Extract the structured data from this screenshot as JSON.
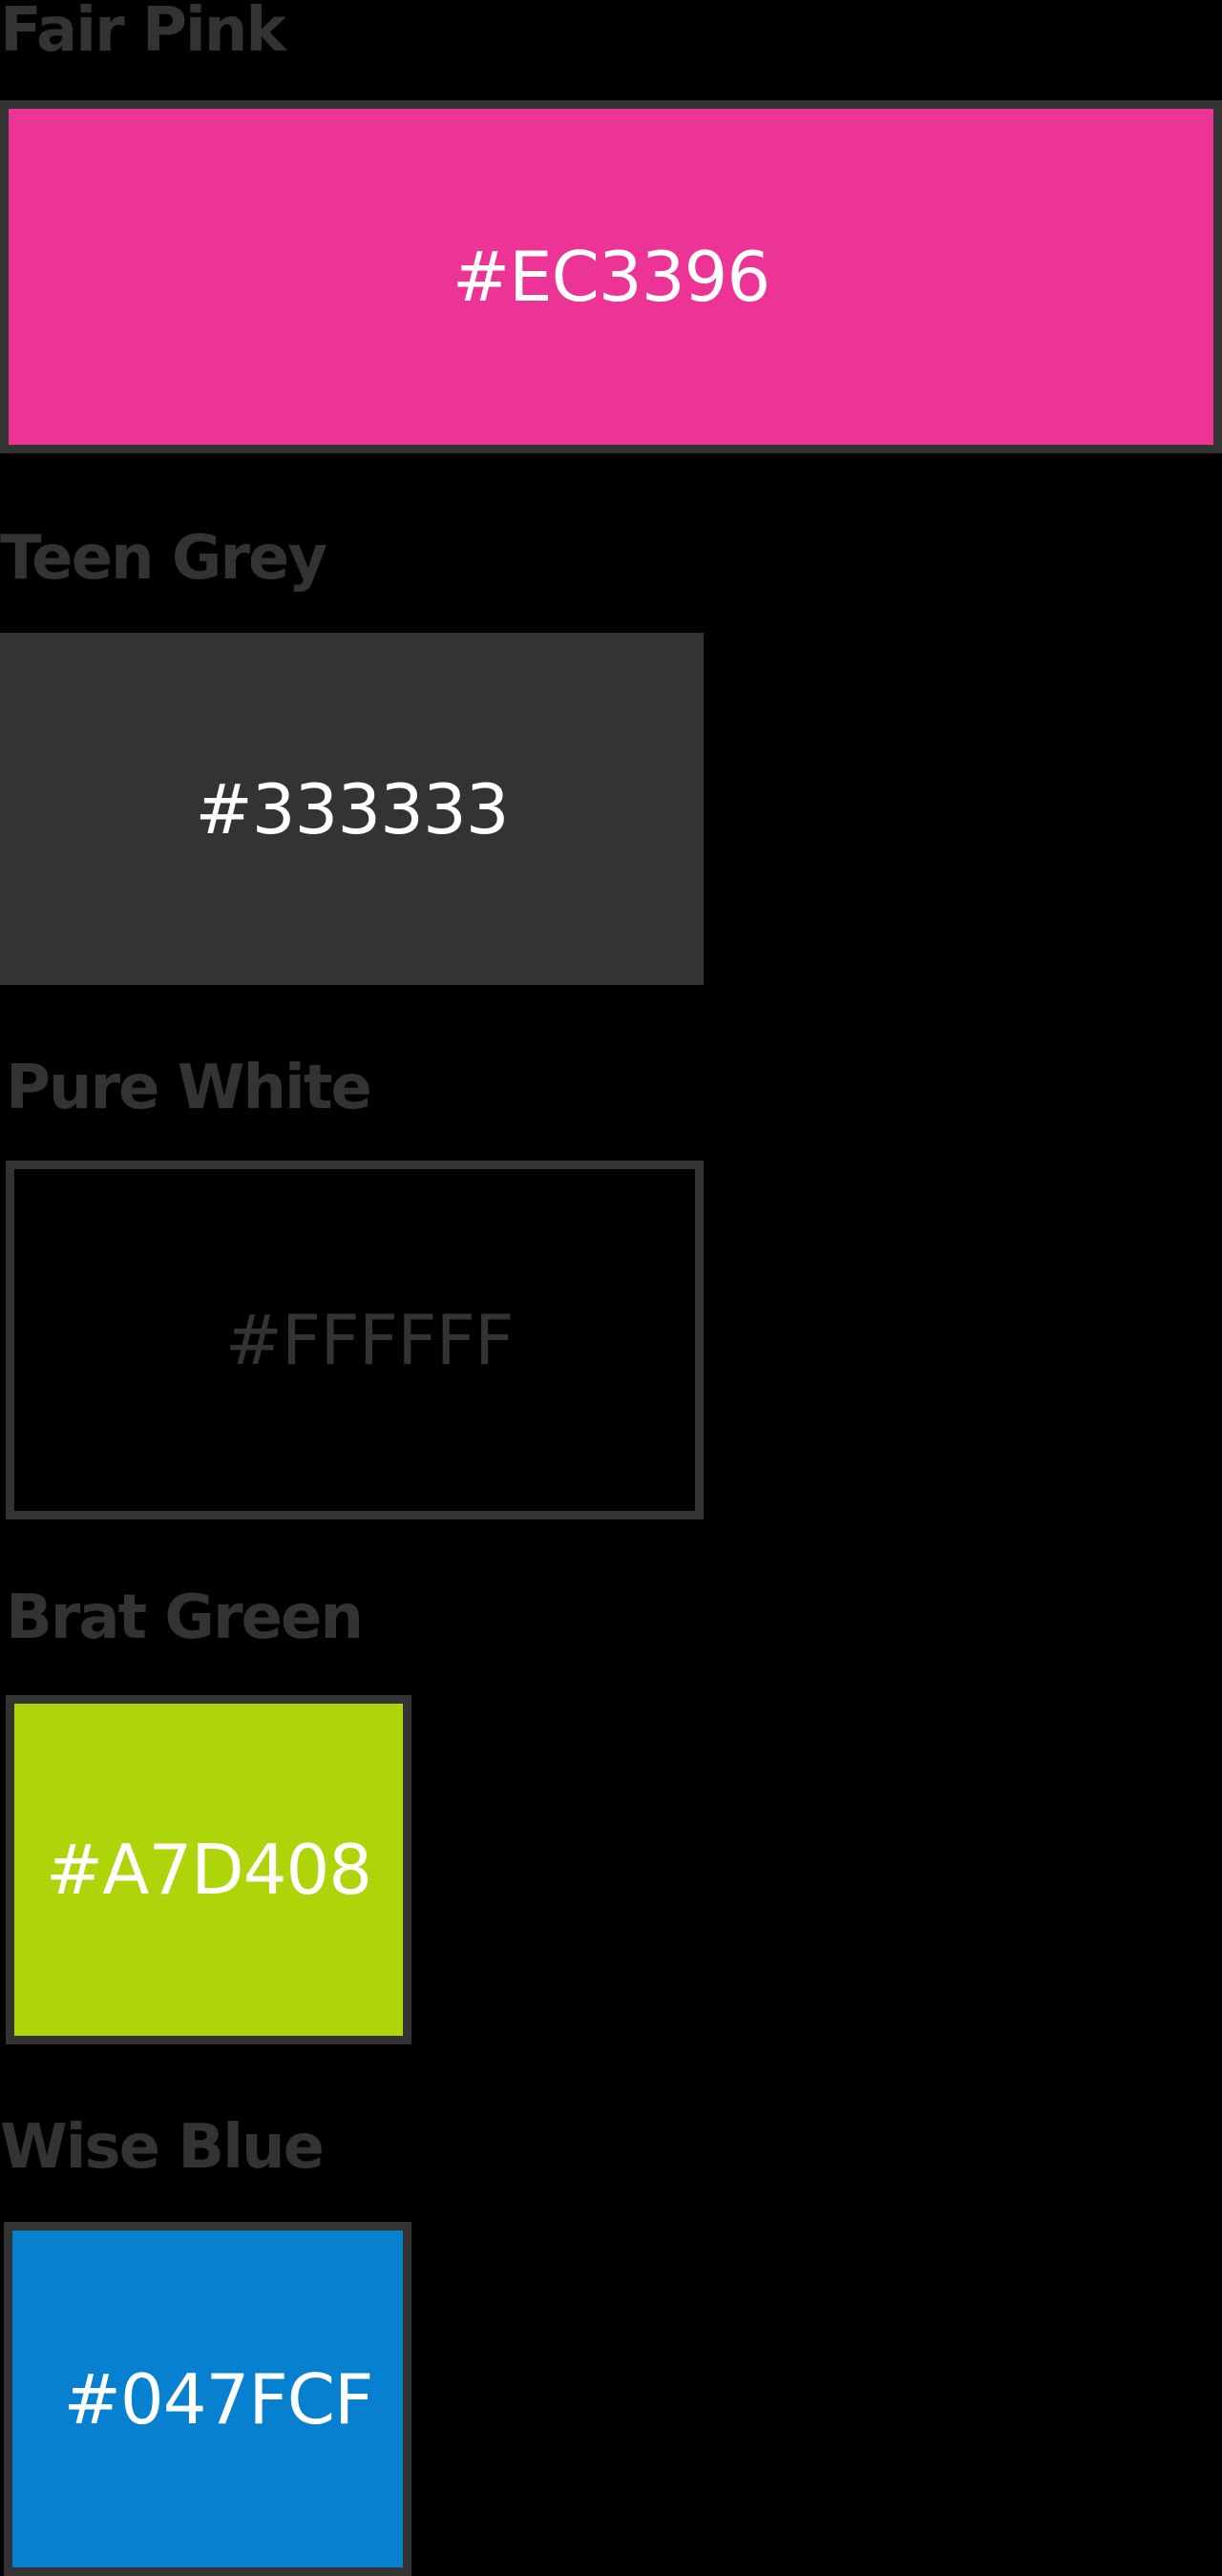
{
  "swatches": {
    "pink": {
      "name": "Fair Pink",
      "hex": "#EC3396",
      "color": "#EC3396",
      "text_color": "#FFFFFF"
    },
    "grey": {
      "name": "Teen Grey",
      "hex": "#333333",
      "color": "#333333",
      "text_color": "#FFFFFF"
    },
    "white": {
      "name": "Pure White",
      "hex": "#FFFFFF",
      "color": "#000000",
      "text_color": "#333333"
    },
    "green": {
      "name": "Brat Green",
      "hex": "#A7D408",
      "color": "#AED40A",
      "text_color": "#FFFFFF"
    },
    "blue": {
      "name": "Wise Blue",
      "hex": "#047FCF",
      "color": "#0780D0",
      "text_color": "#FFFFFF"
    }
  },
  "colors": {
    "background": "#000000",
    "label": "#333333",
    "border": "#333333"
  }
}
